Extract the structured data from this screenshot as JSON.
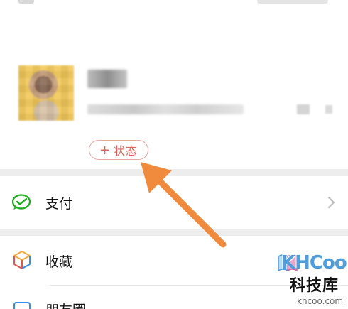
{
  "profile": {
    "status_button": {
      "plus": "+",
      "label": "状态"
    }
  },
  "menu": {
    "items": [
      {
        "label": "支付",
        "icon": "wechat-pay-icon"
      },
      {
        "label": "收藏",
        "icon": "favorites-cube-icon"
      },
      {
        "label": "朋友圈",
        "icon": "moments-icon"
      }
    ]
  },
  "colors": {
    "accent_red": "#d9645a",
    "pay_green": "#1aad19",
    "arrow_orange": "#f08a3c",
    "watermark_blue": "#4f9edb"
  },
  "watermark": {
    "title": "KHCoo",
    "cn": "科技库",
    "domain": "khcoo.com"
  }
}
